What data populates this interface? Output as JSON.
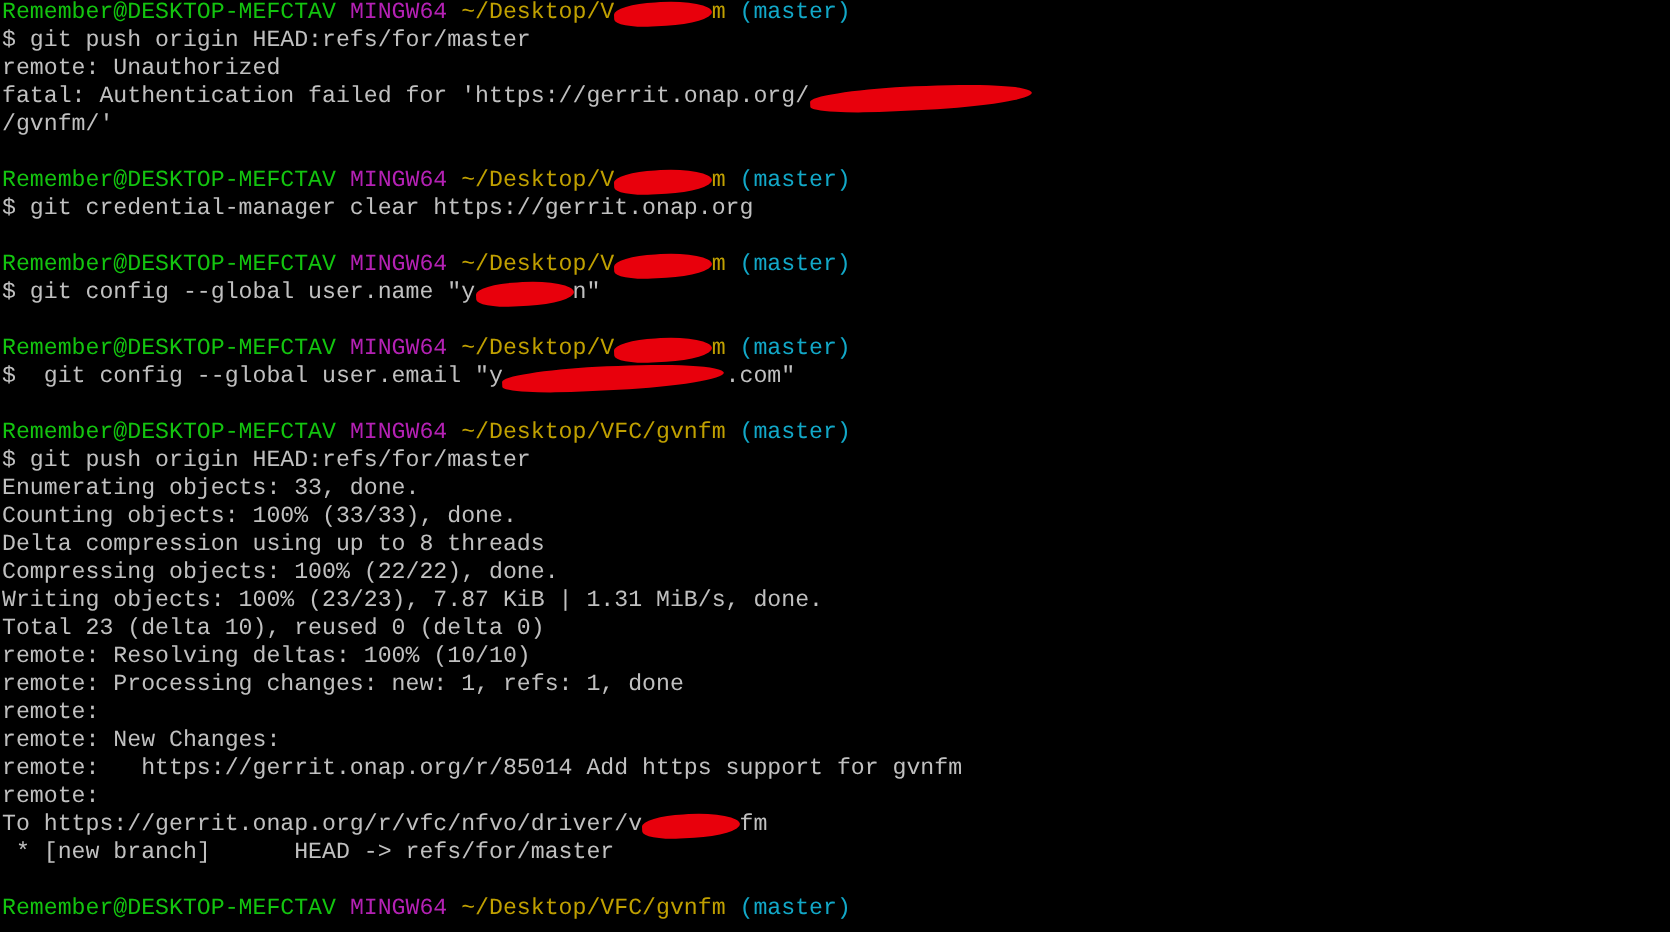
{
  "terminal": {
    "lines": [
      {
        "segments": [
          {
            "kind": "user",
            "text": "Remember@DESKTOP-MEFCTAV"
          },
          {
            "kind": "system",
            "text": "MINGW64"
          },
          {
            "kind": "path",
            "text": "~/Desktop/V"
          },
          {
            "kind": "scribble"
          },
          {
            "kind": "path",
            "text": "m"
          },
          {
            "kind": "branch",
            "text": "(master)"
          }
        ]
      },
      {
        "segments": [
          {
            "kind": "plain",
            "text": "$ git push origin HEAD:refs/for/master"
          }
        ]
      },
      {
        "segments": [
          {
            "kind": "plain",
            "text": "remote: Unauthorized"
          }
        ]
      },
      {
        "segments": [
          {
            "kind": "plain",
            "text": "fatal: Authentication failed for 'https://gerrit.onap.org/"
          },
          {
            "kind": "scribble-long"
          }
        ]
      },
      {
        "segments": [
          {
            "kind": "plain",
            "text": "/gvnfm/'"
          }
        ],
        "blank_after": true
      },
      {
        "segments": [
          {
            "kind": "user",
            "text": "Remember@DESKTOP-MEFCTAV"
          },
          {
            "kind": "system",
            "text": "MINGW64"
          },
          {
            "kind": "path",
            "text": "~/Desktop/V"
          },
          {
            "kind": "scribble"
          },
          {
            "kind": "path",
            "text": "m"
          },
          {
            "kind": "branch",
            "text": "(master)"
          }
        ]
      },
      {
        "segments": [
          {
            "kind": "plain",
            "text": "$ git credential-manager clear https://gerrit.onap.org"
          }
        ],
        "blank_after": true
      },
      {
        "segments": [
          {
            "kind": "user",
            "text": "Remember@DESKTOP-MEFCTAV"
          },
          {
            "kind": "system",
            "text": "MINGW64"
          },
          {
            "kind": "path",
            "text": "~/Desktop/V"
          },
          {
            "kind": "scribble"
          },
          {
            "kind": "path",
            "text": "m"
          },
          {
            "kind": "branch",
            "text": "(master)"
          }
        ]
      },
      {
        "segments": [
          {
            "kind": "plain",
            "text": "$ git config --global user.name \"y"
          },
          {
            "kind": "scribble"
          },
          {
            "kind": "plain",
            "text": "n\""
          }
        ],
        "blank_after": true
      },
      {
        "segments": [
          {
            "kind": "user",
            "text": "Remember@DESKTOP-MEFCTAV"
          },
          {
            "kind": "system",
            "text": "MINGW64"
          },
          {
            "kind": "path",
            "text": "~/Desktop/V"
          },
          {
            "kind": "scribble"
          },
          {
            "kind": "path",
            "text": "m"
          },
          {
            "kind": "branch",
            "text": "(master)"
          }
        ]
      },
      {
        "segments": [
          {
            "kind": "plain",
            "text": "$  git config --global user.email \"y"
          },
          {
            "kind": "scribble-long"
          },
          {
            "kind": "plain",
            "text": ".com\""
          }
        ],
        "blank_after": true
      },
      {
        "segments": [
          {
            "kind": "user",
            "text": "Remember@DESKTOP-MEFCTAV"
          },
          {
            "kind": "system",
            "text": "MINGW64"
          },
          {
            "kind": "path",
            "text": "~/Desktop/VFC/gvnfm"
          },
          {
            "kind": "branch",
            "text": "(master)"
          }
        ]
      },
      {
        "segments": [
          {
            "kind": "plain",
            "text": "$ git push origin HEAD:refs/for/master"
          }
        ]
      },
      {
        "segments": [
          {
            "kind": "plain",
            "text": "Enumerating objects: 33, done."
          }
        ]
      },
      {
        "segments": [
          {
            "kind": "plain",
            "text": "Counting objects: 100% (33/33), done."
          }
        ]
      },
      {
        "segments": [
          {
            "kind": "plain",
            "text": "Delta compression using up to 8 threads"
          }
        ]
      },
      {
        "segments": [
          {
            "kind": "plain",
            "text": "Compressing objects: 100% (22/22), done."
          }
        ]
      },
      {
        "segments": [
          {
            "kind": "plain",
            "text": "Writing objects: 100% (23/23), 7.87 KiB | 1.31 MiB/s, done."
          }
        ]
      },
      {
        "segments": [
          {
            "kind": "plain",
            "text": "Total 23 (delta 10), reused 0 (delta 0)"
          }
        ]
      },
      {
        "segments": [
          {
            "kind": "plain",
            "text": "remote: Resolving deltas: 100% (10/10)"
          }
        ]
      },
      {
        "segments": [
          {
            "kind": "plain",
            "text": "remote: Processing changes: new: 1, refs: 1, done"
          }
        ]
      },
      {
        "segments": [
          {
            "kind": "plain",
            "text": "remote:"
          }
        ]
      },
      {
        "segments": [
          {
            "kind": "plain",
            "text": "remote: New Changes:"
          }
        ]
      },
      {
        "segments": [
          {
            "kind": "plain",
            "text": "remote:   https://gerrit.onap.org/r/85014 Add https support for gvnfm"
          }
        ]
      },
      {
        "segments": [
          {
            "kind": "plain",
            "text": "remote:"
          }
        ]
      },
      {
        "segments": [
          {
            "kind": "plain",
            "text": "To https://gerrit.onap.org/r/vfc/nfvo/driver/v"
          },
          {
            "kind": "scribble"
          },
          {
            "kind": "plain",
            "text": "fm"
          }
        ]
      },
      {
        "segments": [
          {
            "kind": "plain",
            "text": " * [new branch]      HEAD -> refs/for/master"
          }
        ],
        "blank_after": true
      },
      {
        "segments": [
          {
            "kind": "user",
            "text": "Remember@DESKTOP-MEFCTAV"
          },
          {
            "kind": "system",
            "text": "MINGW64"
          },
          {
            "kind": "path",
            "text": "~/Desktop/VFC/gvnfm"
          },
          {
            "kind": "branch",
            "text": "(master)"
          }
        ]
      }
    ]
  }
}
